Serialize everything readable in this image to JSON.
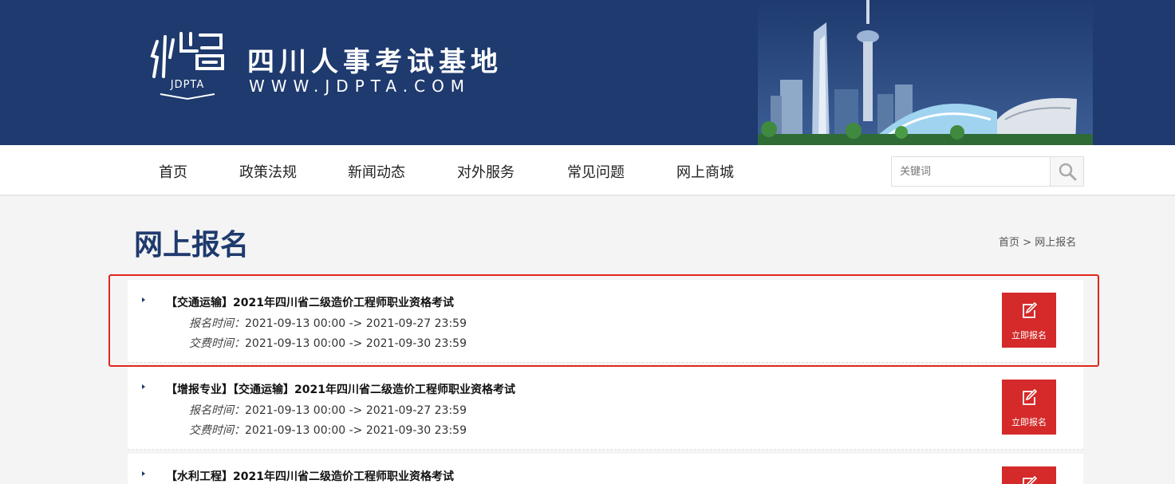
{
  "site": {
    "name": "四川人事考试基地",
    "url": "WWW.JDPTA.COM",
    "logo_text": "JDPTA"
  },
  "nav": {
    "items": [
      "首页",
      "政策法规",
      "新闻动态",
      "对外服务",
      "常见问题",
      "网上商城"
    ],
    "search_placeholder": "关键词"
  },
  "page": {
    "title": "网上报名",
    "breadcrumb": [
      "首页",
      "网上报名"
    ],
    "breadcrumb_sep": ">"
  },
  "labels": {
    "reg_time": "报名时间：",
    "pay_time": "交费时间：",
    "apply": "立即报名"
  },
  "exams": [
    {
      "title": "【交通运输】2021年四川省二级造价工程师职业资格考试",
      "reg": "2021-09-13 00:00 -> 2021-09-27 23:59",
      "pay": "2021-09-13 00:00 -> 2021-09-30 23:59"
    },
    {
      "title": "【增报专业】【交通运输】2021年四川省二级造价工程师职业资格考试",
      "reg": "2021-09-13 00:00 -> 2021-09-27 23:59",
      "pay": "2021-09-13 00:00 -> 2021-09-30 23:59"
    },
    {
      "title": "【水利工程】2021年四川省二级造价工程师职业资格考试"
    }
  ],
  "colors": {
    "brand": "#1e3a6e",
    "accent": "#d42a2a"
  }
}
